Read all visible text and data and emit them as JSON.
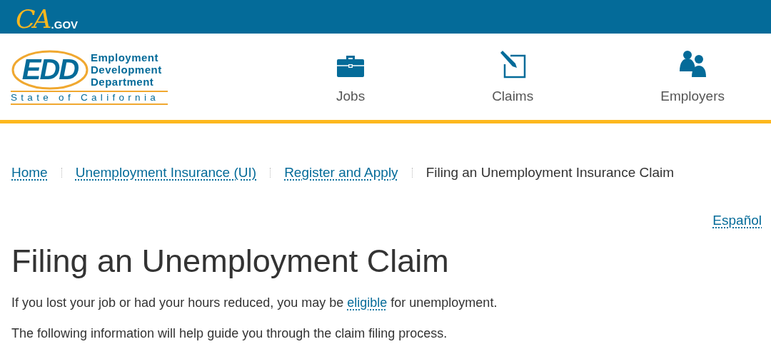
{
  "top_bar": {
    "logo": {
      "script": "CA",
      "suffix": ".GOV"
    }
  },
  "header": {
    "logo": {
      "initials": "EDD",
      "name_lines": [
        "Employment",
        "Development",
        "Department"
      ],
      "state": "State of California"
    },
    "nav": [
      {
        "label": "Jobs",
        "kind": "briefcase"
      },
      {
        "label": "Claims",
        "kind": "edit"
      },
      {
        "label": "Employers",
        "kind": "people"
      }
    ]
  },
  "breadcrumb": [
    {
      "label": "Home",
      "link": true
    },
    {
      "label": "Unemployment Insurance (UI)",
      "link": true
    },
    {
      "label": "Register and Apply",
      "link": true
    },
    {
      "label": "Filing an Unemployment Insurance Claim",
      "link": false
    }
  ],
  "language_link": "Español",
  "title": "Filing an Unemployment Claim",
  "paragraphs": [
    {
      "before": "If you lost your job or had your hours reduced, you may be ",
      "link": "eligible",
      "after": " for unemployment."
    },
    {
      "before": "The following information will help guide you through the claim filing process."
    }
  ]
}
